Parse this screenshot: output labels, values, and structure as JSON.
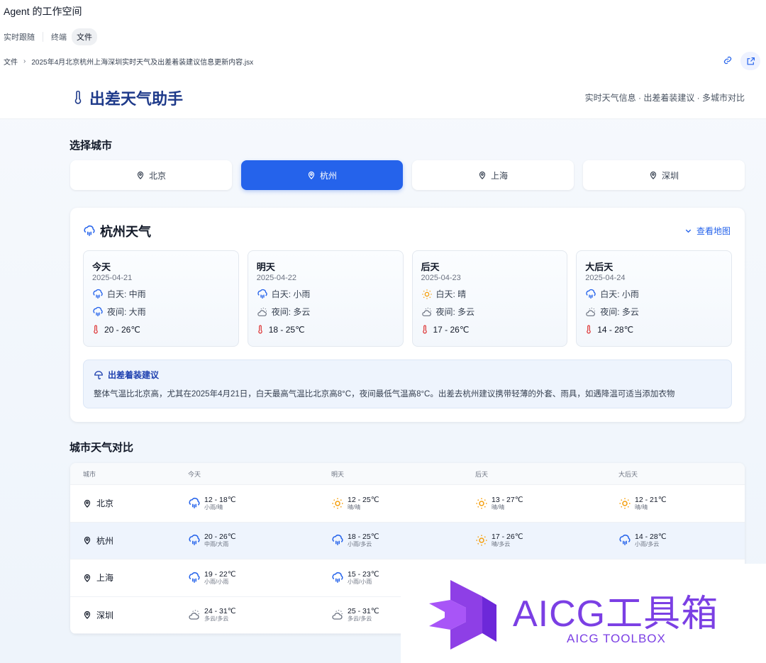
{
  "workspace": {
    "title": "Agent 的工作空间",
    "tabs": [
      "实时跟随",
      "终端",
      "文件"
    ],
    "active_tab": "文件"
  },
  "breadcrumb": {
    "root": "文件",
    "file": "2025年4月北京杭州上海深圳实时天气及出差着装建议信息更新内容.jsx"
  },
  "app": {
    "title": "出差天气助手",
    "subtitle": "实时天气信息 · 出差着装建议 · 多城市对比",
    "select_label": "选择城市",
    "cities": [
      "北京",
      "杭州",
      "上海",
      "深圳"
    ],
    "selected_city": "杭州",
    "weather_card": {
      "title": "杭州天气",
      "map_link": "查看地图",
      "days": [
        {
          "name": "今天",
          "date": "2025-04-21",
          "day_icon": "rain-icon",
          "day": "白天: 中雨",
          "night_icon": "rain-icon",
          "night": "夜间: 大雨",
          "temp": "20 - 26℃"
        },
        {
          "name": "明天",
          "date": "2025-04-22",
          "day_icon": "rain-icon",
          "day": "白天: 小雨",
          "night_icon": "cloudy-icon",
          "night": "夜间: 多云",
          "temp": "18 - 25℃"
        },
        {
          "name": "后天",
          "date": "2025-04-23",
          "day_icon": "sun-icon",
          "day": "白天: 晴",
          "night_icon": "cloudy-icon",
          "night": "夜间: 多云",
          "temp": "17 - 26℃"
        },
        {
          "name": "大后天",
          "date": "2025-04-24",
          "day_icon": "rain-icon",
          "day": "白天: 小雨",
          "night_icon": "cloudy-icon",
          "night": "夜间: 多云",
          "temp": "14 - 28℃"
        }
      ],
      "advice_title": "出差着装建议",
      "advice_text": "整体气温比北京高，尤其在2025年4月21日，白天最高气温比北京高8°C，夜间最低气温高8°C。出差去杭州建议携带轻薄的外套、雨具，如遇降温可适当添加衣物"
    },
    "compare": {
      "title": "城市天气对比",
      "headers": [
        "城市",
        "今天",
        "明天",
        "后天",
        "大后天"
      ],
      "rows": [
        {
          "city": "北京",
          "cells": [
            {
              "icon": "rain-icon",
              "temp": "12 - 18℃",
              "desc": "小雨/晴"
            },
            {
              "icon": "sun-icon",
              "temp": "12 - 25℃",
              "desc": "晴/晴"
            },
            {
              "icon": "sun-icon",
              "temp": "13 - 27℃",
              "desc": "晴/晴"
            },
            {
              "icon": "sun-icon",
              "temp": "12 - 21℃",
              "desc": "晴/晴"
            }
          ]
        },
        {
          "city": "杭州",
          "cells": [
            {
              "icon": "rain-icon",
              "temp": "20 - 26℃",
              "desc": "中雨/大雨"
            },
            {
              "icon": "rain-icon",
              "temp": "18 - 25℃",
              "desc": "小雨/多云"
            },
            {
              "icon": "sun-icon",
              "temp": "17 - 26℃",
              "desc": "晴/多云"
            },
            {
              "icon": "rain-icon",
              "temp": "14 - 28℃",
              "desc": "小雨/多云"
            }
          ]
        },
        {
          "city": "上海",
          "cells": [
            {
              "icon": "rain-icon",
              "temp": "19 - 22℃",
              "desc": "小雨/小雨"
            },
            {
              "icon": "rain-icon",
              "temp": "15 - 23℃",
              "desc": "小雨/小雨"
            }
          ]
        },
        {
          "city": "深圳",
          "cells": [
            {
              "icon": "cloudy-icon",
              "temp": "24 - 31℃",
              "desc": "多云/多云"
            },
            {
              "icon": "cloudy-icon",
              "temp": "25 - 31℃",
              "desc": "多云/多云"
            }
          ]
        }
      ]
    }
  },
  "watermark": {
    "text": "AICG工具箱",
    "sub": "AICG TOOLBOX"
  },
  "colors": {
    "accent": "#2563eb",
    "title": "#1e3a8a",
    "sun": "#f59e0b",
    "thermometer": "#dc2626",
    "watermark": "#7b3fe4"
  }
}
